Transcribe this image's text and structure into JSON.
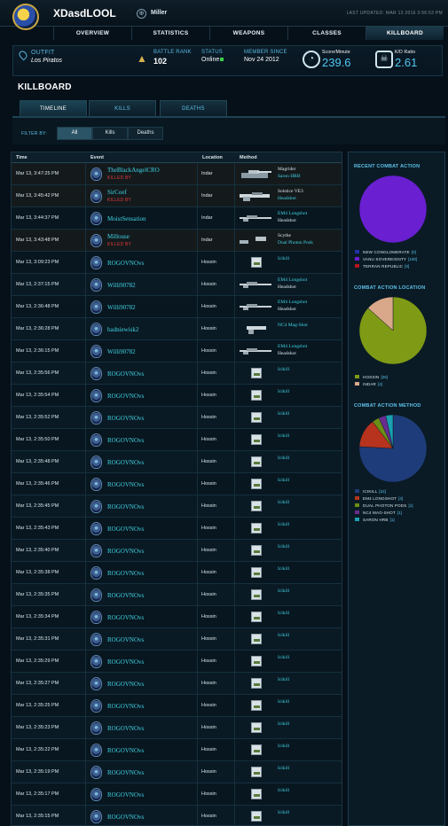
{
  "header": {
    "username": "XDasdLOOL",
    "server": "Miller",
    "last_updated": "LAST UPDATED: MAR 13 2016 3:56:53 PM",
    "nav": [
      "OVERVIEW",
      "STATISTICS",
      "WEAPONS",
      "CLASSES",
      "KILLBOARD"
    ],
    "active_nav": "KILLBOARD"
  },
  "info": {
    "outfit_label": "OUTFIT",
    "outfit_value": "Los Piratos",
    "battle_rank_label": "BATTLE RANK",
    "battle_rank_value": "102",
    "status_label": "STATUS",
    "status_value": "Online",
    "member_since_label": "MEMBER SINCE",
    "member_since_value": "Nov 24 2012",
    "score_label": "Score/Minute",
    "score_value": "239.6",
    "kd_label": "K/D Ratio",
    "kd_value": "2.61"
  },
  "killboard": {
    "title": "KILLBOARD",
    "tabs": [
      "TIMELINE",
      "KILLS",
      "DEATHS"
    ],
    "filter_label": "FILTER BY:",
    "filters": [
      "All",
      "Kills",
      "Deaths"
    ],
    "columns": [
      "Time",
      "Event",
      "Location",
      "Method"
    ],
    "rows": [
      {
        "time": "Mar 13, 3:47:25 PM",
        "player": "TheBlackAngelCRO",
        "killed_by": "KILLED BY",
        "location": "Indar",
        "method": "Magrider",
        "sub": "Saron HRB",
        "weapon": "tank"
      },
      {
        "time": "Mar 13, 3:45:42 PM",
        "player": "SirCoef",
        "killed_by": "KILLED BY",
        "location": "Indar",
        "method": "Solstice VE3",
        "sub": "Headshot",
        "weapon": "rifle"
      },
      {
        "time": "Mar 13, 3:44:37 PM",
        "player": "MoistSensation",
        "killed_by": "",
        "location": "Indar",
        "method": "EM4 Longshot",
        "sub": "Headshot",
        "weapon": "sniper"
      },
      {
        "time": "Mar 13, 3:43:48 PM",
        "player": "Millouse",
        "killed_by": "KILLED BY",
        "location": "Indar",
        "method": "Scythe",
        "sub": "Dual Photon Pods",
        "weapon": "air"
      },
      {
        "time": "Mar 13, 3:09:23 PM",
        "player": "ROGOVNOvs",
        "killed_by": "",
        "location": "Hossin",
        "method": "Icikill",
        "sub": "",
        "weapon": "small"
      },
      {
        "time": "Mar 13, 2:37:15 PM",
        "player": "Willi90782",
        "killed_by": "",
        "location": "Hossin",
        "method": "EM4 Longshot",
        "sub": "Headshot",
        "weapon": "sniper"
      },
      {
        "time": "Mar 13, 2:36:48 PM",
        "player": "Willi90782",
        "killed_by": "",
        "location": "Hossin",
        "method": "EM4 Longshot",
        "sub": "Headshot",
        "weapon": "sniper"
      },
      {
        "time": "Mar 13, 2:36:28 PM",
        "player": "badniewisk2",
        "killed_by": "",
        "location": "Hossin",
        "method": "NC4 Mag-Shot",
        "sub": "",
        "weapon": "pistol"
      },
      {
        "time": "Mar 13, 2:36:15 PM",
        "player": "Willi90782",
        "killed_by": "",
        "location": "Hossin",
        "method": "EM4 Longshot",
        "sub": "Headshot",
        "weapon": "sniper"
      },
      {
        "time": "Mar 13, 2:35:56 PM",
        "player": "ROGOVNOvs",
        "killed_by": "",
        "location": "Hossin",
        "method": "Icikill",
        "sub": "",
        "weapon": "small"
      },
      {
        "time": "Mar 13, 2:35:54 PM",
        "player": "ROGOVNOvs",
        "killed_by": "",
        "location": "Hossin",
        "method": "Icikill",
        "sub": "",
        "weapon": "small"
      },
      {
        "time": "Mar 13, 2:35:52 PM",
        "player": "ROGOVNOvs",
        "killed_by": "",
        "location": "Hossin",
        "method": "Icikill",
        "sub": "",
        "weapon": "small"
      },
      {
        "time": "Mar 13, 2:35:50 PM",
        "player": "ROGOVNOvs",
        "killed_by": "",
        "location": "Hossin",
        "method": "Icikill",
        "sub": "",
        "weapon": "small"
      },
      {
        "time": "Mar 13, 2:35:48 PM",
        "player": "ROGOVNOvs",
        "killed_by": "",
        "location": "Hossin",
        "method": "Icikill",
        "sub": "",
        "weapon": "small"
      },
      {
        "time": "Mar 13, 2:35:46 PM",
        "player": "ROGOVNOvs",
        "killed_by": "",
        "location": "Hossin",
        "method": "Icikill",
        "sub": "",
        "weapon": "small"
      },
      {
        "time": "Mar 13, 2:35:45 PM",
        "player": "ROGOVNOvs",
        "killed_by": "",
        "location": "Hossin",
        "method": "Icikill",
        "sub": "",
        "weapon": "small"
      },
      {
        "time": "Mar 13, 2:35:43 PM",
        "player": "ROGOVNOvs",
        "killed_by": "",
        "location": "Hossin",
        "method": "Icikill",
        "sub": "",
        "weapon": "small"
      },
      {
        "time": "Mar 13, 2:35:40 PM",
        "player": "ROGOVNOvs",
        "killed_by": "",
        "location": "Hossin",
        "method": "Icikill",
        "sub": "",
        "weapon": "small"
      },
      {
        "time": "Mar 13, 2:35:38 PM",
        "player": "ROGOVNOvs",
        "killed_by": "",
        "location": "Hossin",
        "method": "Icikill",
        "sub": "",
        "weapon": "small"
      },
      {
        "time": "Mar 13, 2:35:35 PM",
        "player": "ROGOVNOvs",
        "killed_by": "",
        "location": "Hossin",
        "method": "Icikill",
        "sub": "",
        "weapon": "small"
      },
      {
        "time": "Mar 13, 2:35:34 PM",
        "player": "ROGOVNOvs",
        "killed_by": "",
        "location": "Hossin",
        "method": "Icikill",
        "sub": "",
        "weapon": "small"
      },
      {
        "time": "Mar 13, 2:35:31 PM",
        "player": "ROGOVNOvs",
        "killed_by": "",
        "location": "Hossin",
        "method": "Icikill",
        "sub": "",
        "weapon": "small"
      },
      {
        "time": "Mar 13, 2:35:29 PM",
        "player": "ROGOVNOvs",
        "killed_by": "",
        "location": "Hossin",
        "method": "Icikill",
        "sub": "",
        "weapon": "small"
      },
      {
        "time": "Mar 13, 2:35:27 PM",
        "player": "ROGOVNOvs",
        "killed_by": "",
        "location": "Hossin",
        "method": "Icikill",
        "sub": "",
        "weapon": "small"
      },
      {
        "time": "Mar 13, 2:35:25 PM",
        "player": "ROGOVNOvs",
        "killed_by": "",
        "location": "Hossin",
        "method": "Icikill",
        "sub": "",
        "weapon": "small"
      },
      {
        "time": "Mar 13, 2:35:23 PM",
        "player": "ROGOVNOvs",
        "killed_by": "",
        "location": "Hossin",
        "method": "Icikill",
        "sub": "",
        "weapon": "small"
      },
      {
        "time": "Mar 13, 2:35:22 PM",
        "player": "ROGOVNOvs",
        "killed_by": "",
        "location": "Hossin",
        "method": "Icikill",
        "sub": "",
        "weapon": "small"
      },
      {
        "time": "Mar 13, 2:35:19 PM",
        "player": "ROGOVNOvs",
        "killed_by": "",
        "location": "Hossin",
        "method": "Icikill",
        "sub": "",
        "weapon": "small"
      },
      {
        "time": "Mar 13, 2:35:17 PM",
        "player": "ROGOVNOvs",
        "killed_by": "",
        "location": "Hossin",
        "method": "Icikill",
        "sub": "",
        "weapon": "small"
      },
      {
        "time": "Mar 13, 2:35:15 PM",
        "player": "ROGOVNOvs",
        "killed_by": "",
        "location": "Hossin",
        "method": "Icikill",
        "sub": "",
        "weapon": "small"
      }
    ]
  },
  "chart_data": [
    {
      "type": "pie",
      "title": "RECENT COMBAT ACTION",
      "categories": [
        "NEW CONGLOMERATE",
        "VANU SOVEREIGNTY",
        "TERRAN REPUBLIC"
      ],
      "values": [
        0,
        100,
        0
      ],
      "colors": [
        "#2232a8",
        "#6a1fd1",
        "#b3141c"
      ]
    },
    {
      "type": "pie",
      "title": "COMBAT ACTION LOCATION",
      "categories": [
        "HOSSIN",
        "INDAR"
      ],
      "values": [
        26,
        4
      ],
      "colors": [
        "#7f9b15",
        "#d9a78a"
      ]
    },
    {
      "type": "pie",
      "title": "COMBAT ACTION METHOD",
      "categories": [
        "ICIKILL",
        "EM4 LONGSHOT",
        "DUAL PHOTON PODS",
        "NC4 MAG-SHOT",
        "SARON HRB"
      ],
      "values": [
        22,
        4,
        1,
        1,
        1
      ],
      "colors": [
        "#1f3c7a",
        "#b7331e",
        "#6b8e14",
        "#6a2c8f",
        "#1aa0b0"
      ]
    }
  ]
}
